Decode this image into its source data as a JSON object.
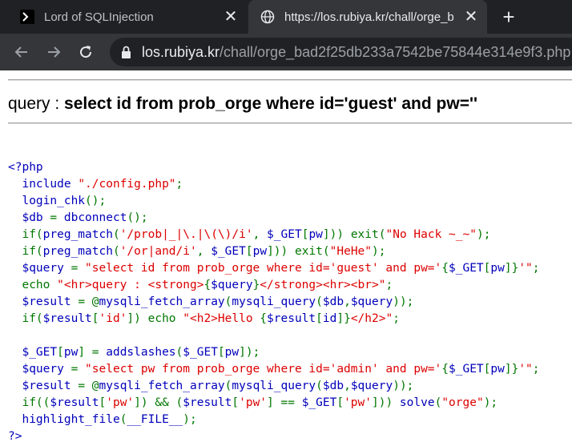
{
  "tabs": [
    {
      "title": "Lord of SQLInjection",
      "icon": "los-favicon",
      "active": false
    },
    {
      "title": "https://los.rubiya.kr/chall/orge_b",
      "icon": "globe-icon",
      "active": true
    }
  ],
  "address_bar": {
    "host": "los.rubiya.kr",
    "path": "/chall/orge_bad2f25db233a7542be75844e314e9f3.php"
  },
  "query_line": {
    "label": "query : ",
    "query": "select id from prob_orge where id='guest' and pw=''"
  },
  "source_code": [
    [
      [
        "d",
        "<?php"
      ]
    ],
    [
      [
        "d",
        "  include "
      ],
      [
        "s",
        "\"./config.php\""
      ],
      [
        "k",
        ";"
      ]
    ],
    [
      [
        "d",
        "  login_chk"
      ],
      [
        "k",
        "();"
      ]
    ],
    [
      [
        "d",
        "  $db "
      ],
      [
        "k",
        "= "
      ],
      [
        "d",
        "dbconnect"
      ],
      [
        "k",
        "();"
      ]
    ],
    [
      [
        "k",
        "  if("
      ],
      [
        "d",
        "preg_match"
      ],
      [
        "k",
        "("
      ],
      [
        "s",
        "'/prob|_|\\.|\\(\\)/i'"
      ],
      [
        "k",
        ", "
      ],
      [
        "d",
        "$_GET"
      ],
      [
        "k",
        "["
      ],
      [
        "d",
        "pw"
      ],
      [
        "k",
        "])) exit("
      ],
      [
        "s",
        "\"No Hack ~_~\""
      ],
      [
        "k",
        ");"
      ]
    ],
    [
      [
        "k",
        "  if("
      ],
      [
        "d",
        "preg_match"
      ],
      [
        "k",
        "("
      ],
      [
        "s",
        "'/or|and/i'"
      ],
      [
        "k",
        ", "
      ],
      [
        "d",
        "$_GET"
      ],
      [
        "k",
        "["
      ],
      [
        "d",
        "pw"
      ],
      [
        "k",
        "])) exit("
      ],
      [
        "s",
        "\"HeHe\""
      ],
      [
        "k",
        ");"
      ]
    ],
    [
      [
        "d",
        "  $query "
      ],
      [
        "k",
        "= "
      ],
      [
        "s",
        "\"select id from prob_orge where id='guest' and pw='"
      ],
      [
        "k",
        "{"
      ],
      [
        "d",
        "$_GET"
      ],
      [
        "k",
        "["
      ],
      [
        "d",
        "pw"
      ],
      [
        "k",
        "]}"
      ],
      [
        "s",
        "'\""
      ],
      [
        "k",
        ";"
      ]
    ],
    [
      [
        "k",
        "  echo "
      ],
      [
        "s",
        "\"<hr>query : <strong>"
      ],
      [
        "k",
        "{"
      ],
      [
        "d",
        "$query"
      ],
      [
        "k",
        "}"
      ],
      [
        "s",
        "</strong><hr><br>\""
      ],
      [
        "k",
        ";"
      ]
    ],
    [
      [
        "d",
        "  $result "
      ],
      [
        "k",
        "= @"
      ],
      [
        "d",
        "mysqli_fetch_array"
      ],
      [
        "k",
        "("
      ],
      [
        "d",
        "mysqli_query"
      ],
      [
        "k",
        "("
      ],
      [
        "d",
        "$db"
      ],
      [
        "k",
        ","
      ],
      [
        "d",
        "$query"
      ],
      [
        "k",
        "));"
      ]
    ],
    [
      [
        "k",
        "  if("
      ],
      [
        "d",
        "$result"
      ],
      [
        "k",
        "["
      ],
      [
        "s",
        "'id'"
      ],
      [
        "k",
        "]) echo "
      ],
      [
        "s",
        "\"<h2>Hello "
      ],
      [
        "k",
        "{"
      ],
      [
        "d",
        "$result"
      ],
      [
        "k",
        "["
      ],
      [
        "d",
        "id"
      ],
      [
        "k",
        "]}"
      ],
      [
        "s",
        "</h2>\""
      ],
      [
        "k",
        ";"
      ]
    ],
    [],
    [
      [
        "d",
        "  $_GET"
      ],
      [
        "k",
        "["
      ],
      [
        "d",
        "pw"
      ],
      [
        "k",
        "] = "
      ],
      [
        "d",
        "addslashes"
      ],
      [
        "k",
        "("
      ],
      [
        "d",
        "$_GET"
      ],
      [
        "k",
        "["
      ],
      [
        "d",
        "pw"
      ],
      [
        "k",
        "]);"
      ]
    ],
    [
      [
        "d",
        "  $query "
      ],
      [
        "k",
        "= "
      ],
      [
        "s",
        "\"select pw from prob_orge where id='admin' and pw='"
      ],
      [
        "k",
        "{"
      ],
      [
        "d",
        "$_GET"
      ],
      [
        "k",
        "["
      ],
      [
        "d",
        "pw"
      ],
      [
        "k",
        "]}"
      ],
      [
        "s",
        "'\""
      ],
      [
        "k",
        ";"
      ]
    ],
    [
      [
        "d",
        "  $result "
      ],
      [
        "k",
        "= @"
      ],
      [
        "d",
        "mysqli_fetch_array"
      ],
      [
        "k",
        "("
      ],
      [
        "d",
        "mysqli_query"
      ],
      [
        "k",
        "("
      ],
      [
        "d",
        "$db"
      ],
      [
        "k",
        ","
      ],
      [
        "d",
        "$query"
      ],
      [
        "k",
        "));"
      ]
    ],
    [
      [
        "k",
        "  if(("
      ],
      [
        "d",
        "$result"
      ],
      [
        "k",
        "["
      ],
      [
        "s",
        "'pw'"
      ],
      [
        "k",
        "]) && ("
      ],
      [
        "d",
        "$result"
      ],
      [
        "k",
        "["
      ],
      [
        "s",
        "'pw'"
      ],
      [
        "k",
        "] == "
      ],
      [
        "d",
        "$_GET"
      ],
      [
        "k",
        "["
      ],
      [
        "s",
        "'pw'"
      ],
      [
        "k",
        "])) "
      ],
      [
        "d",
        "solve"
      ],
      [
        "k",
        "("
      ],
      [
        "s",
        "\"orge\""
      ],
      [
        "k",
        ");"
      ]
    ],
    [
      [
        "d",
        "  highlight_file"
      ],
      [
        "k",
        "("
      ],
      [
        "d",
        "__FILE__"
      ],
      [
        "k",
        ");"
      ]
    ],
    [
      [
        "d",
        "?>"
      ]
    ]
  ],
  "colors": {
    "tabbar_bg": "#202124",
    "toolbar_bg": "#35363a",
    "php_default": "#0000bb",
    "php_keyword": "#007700",
    "php_string": "#dd0000"
  }
}
